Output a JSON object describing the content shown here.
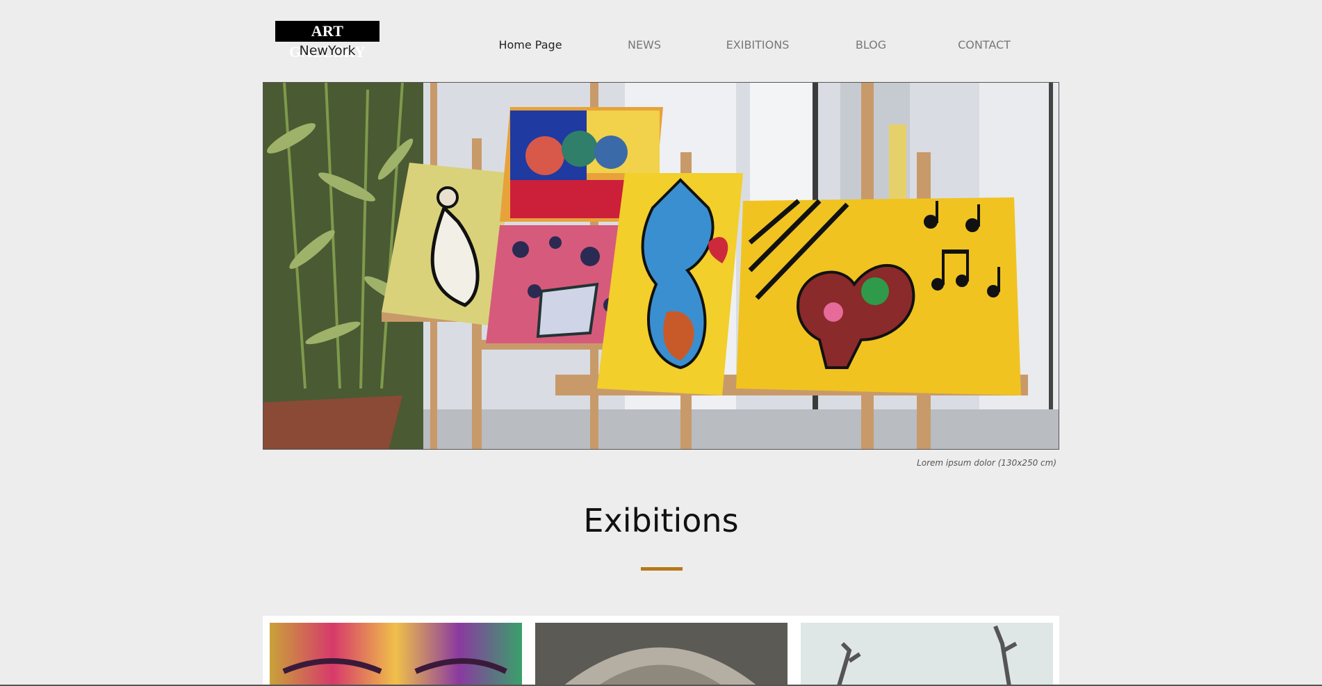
{
  "brand": {
    "name": "ART GALLERY",
    "city": "NewYork"
  },
  "nav": {
    "items": [
      {
        "label": "Home Page",
        "active": true
      },
      {
        "label": "NEWS",
        "active": false
      },
      {
        "label": "EXIBITIONS",
        "active": false
      },
      {
        "label": "BLOG",
        "active": false
      },
      {
        "label": "CONTACT",
        "active": false
      }
    ]
  },
  "hero": {
    "image": "painted-cat-canvases-on-easels",
    "caption": "Lorem ipsum dolor (130x250 cm)"
  },
  "exhibitions": {
    "title": "Exibitions",
    "accent_color": "#b6781a",
    "cards": [
      {
        "image": "colorful-painted-face"
      },
      {
        "image": "stone-arch-sculpture"
      },
      {
        "image": "antlers-sculpture"
      }
    ]
  }
}
